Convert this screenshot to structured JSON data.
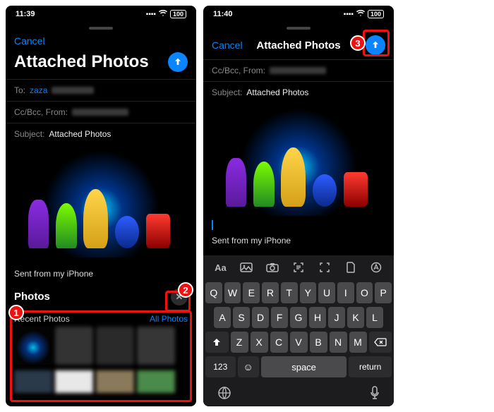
{
  "left": {
    "time": "11:39",
    "battery": "100",
    "cancel": "Cancel",
    "title": "Attached Photos",
    "to_label": "To:",
    "to_value": "zaza",
    "ccbcc_label": "Cc/Bcc, From:",
    "subject_label": "Subject:",
    "subject_value": "Attached Photos",
    "signature": "Sent from my iPhone",
    "photos_header": "Photos",
    "recent_label": "Recent Photos",
    "all_photos": "All Photos"
  },
  "right": {
    "time": "11:40",
    "battery": "100",
    "cancel": "Cancel",
    "title": "Attached Photos",
    "ccbcc_label": "Cc/Bcc, From:",
    "subject_label": "Subject:",
    "subject_value": "Attached Photos",
    "signature": "Sent from my iPhone",
    "toolbar": {
      "aa": "Aa"
    },
    "keys": {
      "row1": [
        "Q",
        "W",
        "E",
        "R",
        "T",
        "Y",
        "U",
        "I",
        "O",
        "P"
      ],
      "row2": [
        "A",
        "S",
        "D",
        "F",
        "G",
        "H",
        "J",
        "K",
        "L"
      ],
      "row3": [
        "Z",
        "X",
        "C",
        "V",
        "B",
        "N",
        "M"
      ],
      "num": "123",
      "space": "space",
      "return": "return"
    }
  },
  "annotations": {
    "b1": "1",
    "b2": "2",
    "b3": "3"
  }
}
